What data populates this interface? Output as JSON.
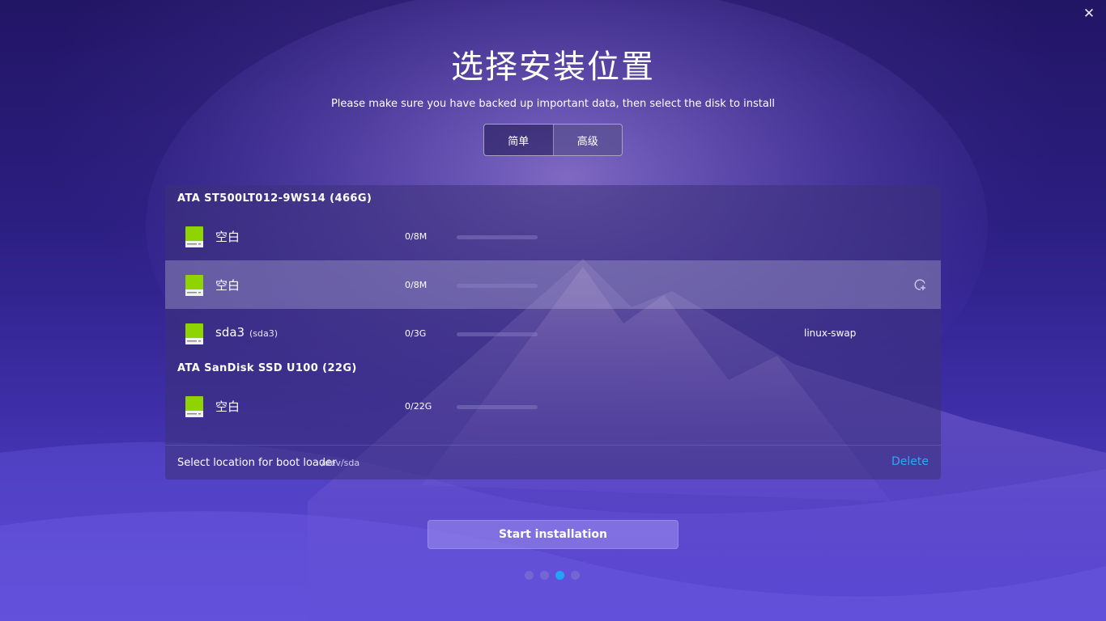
{
  "window": {
    "close_glyph": "✕"
  },
  "header": {
    "title": "选择安装位置",
    "subtitle": "Please make sure you have backed up important data, then select the disk to install"
  },
  "mode_switch": {
    "simple_label": "简单",
    "advanced_label": "高级",
    "active": "advanced"
  },
  "disks": [
    {
      "name": "ATA ST500LT012-9WS14 (466G)",
      "partitions": [
        {
          "name": "空白",
          "sub": "",
          "size": "0/8M",
          "usage": 0,
          "fs": "",
          "selected": false
        },
        {
          "name": "空白",
          "sub": "",
          "size": "0/8M",
          "usage": 0,
          "fs": "",
          "selected": true
        },
        {
          "name": "sda3",
          "sub": "(sda3)",
          "size": "0/3G",
          "usage": 0,
          "fs": "linux-swap",
          "selected": false
        }
      ]
    },
    {
      "name": "ATA SanDisk SSD U100 (22G)",
      "partitions": [
        {
          "name": "空白",
          "sub": "",
          "size": "0/22G",
          "usage": 0,
          "fs": "",
          "selected": false
        }
      ]
    }
  ],
  "footer": {
    "boot_loader_label": "Select location for boot loader",
    "boot_loader_path": "/dev/sda",
    "delete_label": "Delete"
  },
  "actions": {
    "start_label": "Start installation"
  },
  "pagination": {
    "count": 4,
    "current": 3
  },
  "colors": {
    "accent": "#2ca7f8",
    "partition_icon": "#8fd400",
    "dot_active": "#21a4f5"
  },
  "icons": {
    "partition": "disk-partition-icon",
    "new_partition": "add-partition-icon",
    "close": "close-icon"
  }
}
